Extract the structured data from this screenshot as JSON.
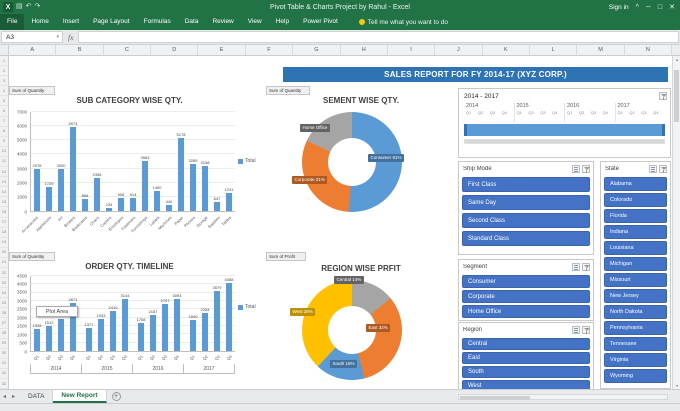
{
  "titlebar": {
    "title": "Pivot Table & Charts Project by Rahul - Excel",
    "sign_in_label": "Sign in"
  },
  "ribbon": {
    "tabs": [
      "File",
      "Home",
      "Insert",
      "Page Layout",
      "Formulas",
      "Data",
      "Review",
      "View",
      "Help",
      "Power Pivot"
    ],
    "tell_me": "Tell me what you want to do"
  },
  "formula_bar": {
    "name_box": "A3",
    "fx_label": "fx"
  },
  "grid": {
    "row_count": 33
  },
  "column_headers": [
    "A",
    "B",
    "C",
    "D",
    "E",
    "F",
    "G",
    "H",
    "I",
    "J",
    "K",
    "L",
    "M",
    "N"
  ],
  "banner": "SALES REPORT FOR FY 2014-17 (XYZ CORP.)",
  "pivot_labels": {
    "chart1": "Sum of Quantity",
    "chart2": "Sum of Quantity",
    "donut1": "Sum of Quantity",
    "donut2": "Sum of Profit"
  },
  "chart_data": [
    {
      "id": "subcategory_qty",
      "type": "bar",
      "title": "SUB CATEGORY WISE QTY.",
      "categories": [
        "Accessories",
        "Appliances",
        "Art",
        "Binders",
        "Bookcases",
        "Chairs",
        "Copiers",
        "Envelopes",
        "Fasteners",
        "Furnishings",
        "Labels",
        "Machines",
        "Paper",
        "Phones",
        "Storage",
        "Supplies",
        "Tables"
      ],
      "values": [
        2976,
        1729,
        3000,
        5974,
        868,
        2356,
        234,
        906,
        914,
        3563,
        1400,
        440,
        5178,
        3289,
        3158,
        647,
        1241
      ],
      "series_name": "Total",
      "bar_color": "#5B9BD5",
      "ylim": [
        0,
        7000
      ],
      "yticks": [
        0,
        1000,
        2000,
        3000,
        4000,
        5000,
        6000,
        7000
      ],
      "legend_position": "right",
      "grid": true
    },
    {
      "id": "order_qty_timeline",
      "type": "bar",
      "title": "ORDER QTY. TIMELINE",
      "categories": [
        "Q1",
        "Q2",
        "Q3",
        "Q4",
        "Q1",
        "Q2",
        "Q3",
        "Q4",
        "Q1",
        "Q2",
        "Q3",
        "Q4",
        "Q1",
        "Q2",
        "Q3",
        "Q4"
      ],
      "years": [
        "2014",
        "2015",
        "2016",
        "2017"
      ],
      "values": [
        1328,
        1512,
        1931,
        2871,
        1377,
        1933,
        2410,
        3144,
        1708,
        2187,
        2797,
        3093,
        1840,
        2254,
        3579,
        4088
      ],
      "series_name": "Total",
      "bar_color": "#5B9BD5",
      "ylim": [
        0,
        4500
      ],
      "yticks": [
        0,
        500,
        1000,
        1500,
        2000,
        2500,
        3000,
        3500,
        4000,
        4500
      ],
      "legend_position": "right",
      "grid": true,
      "tooltip": "Plot Area"
    },
    {
      "id": "segment_qty",
      "type": "pie",
      "title": "SEMENT WISE QTY.",
      "slices": [
        {
          "name": "Consumer",
          "pct": 51,
          "color": "#5B9BD5",
          "label_color": "#41719C"
        },
        {
          "name": "Corporate",
          "pct": 31,
          "color": "#ED7D31",
          "label_color": "#AE5A21"
        },
        {
          "name": "Home Office",
          "pct": 18,
          "color": "#A5A5A5",
          "label_color": "#636363",
          "show_pct": false
        }
      ]
    },
    {
      "id": "region_profit",
      "type": "pie",
      "title": "REGION WISE PRFIT",
      "slices": [
        {
          "name": "Central",
          "pct": 14,
          "color": "#A5A5A5",
          "label_color": "#636363"
        },
        {
          "name": "East",
          "pct": 32,
          "color": "#ED7D31",
          "label_color": "#AE5A21"
        },
        {
          "name": "South",
          "pct": 16,
          "color": "#5B9BD5",
          "label_color": "#41719C"
        },
        {
          "name": "West",
          "pct": 38,
          "color": "#FFC000",
          "label_color": "#BF9000"
        }
      ]
    }
  ],
  "timeline": {
    "range_label": "2014 - 2017",
    "years": [
      "2014",
      "2015",
      "2016",
      "2017"
    ],
    "quarters": [
      "Q1",
      "Q2",
      "Q3",
      "Q4"
    ]
  },
  "slicers": [
    {
      "title": "Ship Mode",
      "items": [
        "First Class",
        "Same Day",
        "Second Class",
        "Standard Class"
      ]
    },
    {
      "title": "State",
      "items": [
        "Alabama",
        "Colorado",
        "Florida",
        "Indiana",
        "Louisiana",
        "Michigan",
        "Missouri",
        "New Jersey",
        "North Dakota",
        "Pennsylvania",
        "Tennessee",
        "Virginia",
        "Wyoming"
      ]
    },
    {
      "title": "Segment",
      "items": [
        "Consumer",
        "Corporate",
        "Home Office"
      ]
    },
    {
      "title": "Region",
      "items": [
        "Central",
        "East",
        "South",
        "West"
      ]
    }
  ],
  "sheet_tabs": {
    "tabs": [
      "DATA",
      "New Report"
    ],
    "active": "New Report"
  },
  "colors": {
    "excel_green": "#217346",
    "banner_blue": "#2E74B5",
    "bar_blue": "#5B9BD5",
    "slicer_blue": "#4472C4"
  }
}
